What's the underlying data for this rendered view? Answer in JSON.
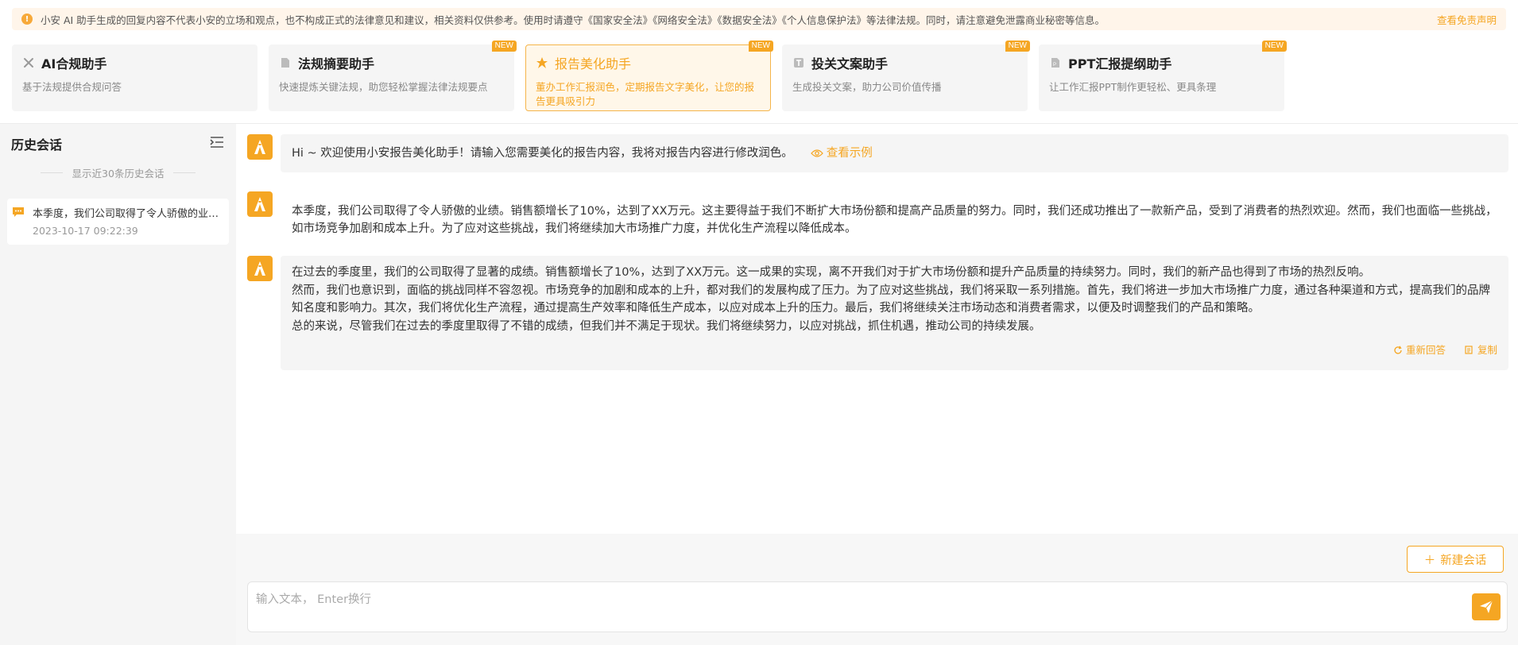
{
  "notice": {
    "text": "小安 AI 助手生成的回复内容不代表小安的立场和观点，也不构成正式的法律意见和建议，相关资料仅供参考。使用时请遵守《国家安全法》《网络安全法》《数据安全法》《个人信息保护法》等法律法规。同时，请注意避免泄露商业秘密等信息。",
    "link": "查看免责声明",
    "icon": "info-icon"
  },
  "cards": [
    {
      "title": "AI合规助手",
      "desc": "基于法规提供合规问答",
      "icon": "scale-icon",
      "badge": ""
    },
    {
      "title": "法规摘要助手",
      "desc": "快速提炼关键法规，助您轻松掌握法律法规要点",
      "icon": "document-icon",
      "badge": "NEW"
    },
    {
      "title": "报告美化助手",
      "desc": "董办工作汇报润色，定期报告文字美化，让您的报告更具吸引力",
      "icon": "magic-icon",
      "badge": "NEW",
      "active": true
    },
    {
      "title": "投关文案助手",
      "desc": "生成投关文案，助力公司价值传播",
      "icon": "text-icon",
      "badge": "NEW"
    },
    {
      "title": "PPT汇报提纲助手",
      "desc": "让工作汇报PPT制作更轻松、更具条理",
      "icon": "ppt-file-icon",
      "badge": "NEW"
    }
  ],
  "sidebar": {
    "title": "历史会话",
    "subtitle": "显示近30条历史会话",
    "history": [
      {
        "title": "本季度，我们公司取得了令人骄傲的业绩。",
        "time": "2023-10-17 09:22:39"
      }
    ]
  },
  "messages": {
    "welcome": "Hi ~ 欢迎使用小安报告美化助手！请输入您需要美化的报告内容，我将对报告内容进行修改润色。",
    "example_link": "查看示例",
    "user_text": "本季度，我们公司取得了令人骄傲的业绩。销售额增长了10%，达到了XX万元。这主要得益于我们不断扩大市场份额和提高产品质量的努力。同时，我们还成功推出了一款新产品，受到了消费者的热烈欢迎。然而，我们也面临一些挑战，如市场竞争加剧和成本上升。为了应对这些挑战，我们将继续加大市场推广力度，并优化生产流程以降低成本。",
    "reply_p1": "在过去的季度里，我们的公司取得了显著的成绩。销售额增长了10%，达到了XX万元。这一成果的实现，离不开我们对于扩大市场份额和提升产品质量的持续努力。同时，我们的新产品也得到了市场的热烈反响。",
    "reply_p2": "然而，我们也意识到，面临的挑战同样不容忽视。市场竞争的加剧和成本的上升，都对我们的发展构成了压力。为了应对这些挑战，我们将采取一系列措施。首先，我们将进一步加大市场推广力度，通过各种渠道和方式，提高我们的品牌知名度和影响力。其次，我们将优化生产流程，通过提高生产效率和降低生产成本，以应对成本上升的压力。最后，我们将继续关注市场动态和消费者需求，以便及时调整我们的产品和策略。",
    "reply_p3": "总的来说，尽管我们在过去的季度里取得了不错的成绩，但我们并不满足于现状。我们将继续努力，以应对挑战，抓住机遇，推动公司的持续发展。",
    "regenerate": "重新回答",
    "copy": "复制"
  },
  "composer": {
    "new_chat": "新建会话",
    "placeholder": "输入文本， Enter换行"
  },
  "colors": {
    "accent": "#f5a623",
    "notice_bg": "#fff5ea",
    "panel_bg": "#f5f5f5"
  }
}
